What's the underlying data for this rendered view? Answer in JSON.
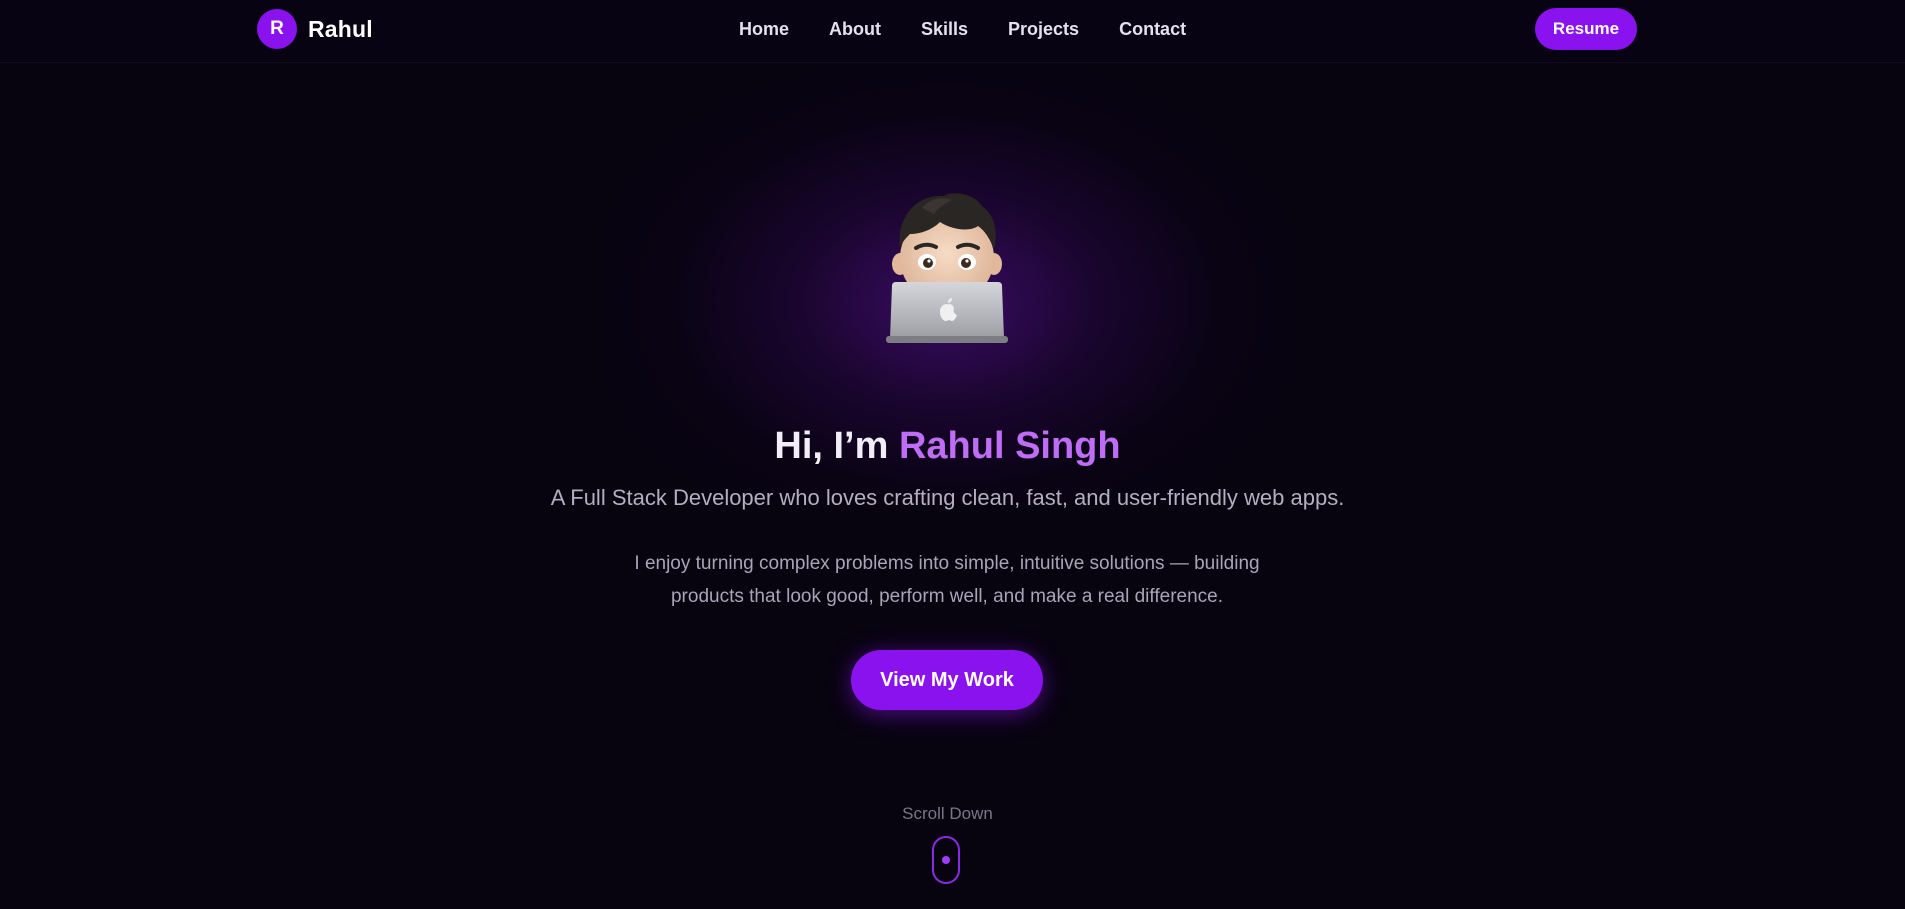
{
  "nav": {
    "brand_initial": "R",
    "brand_name": "Rahul",
    "links": [
      {
        "label": "Home"
      },
      {
        "label": "About"
      },
      {
        "label": "Skills"
      },
      {
        "label": "Projects"
      },
      {
        "label": "Contact"
      }
    ],
    "resume_label": "Resume"
  },
  "hero": {
    "avatar_icon": "memoji-with-laptop-icon",
    "title_prefix": "Hi, I’m ",
    "title_name": "Rahul Singh",
    "subtitle": "A Full Stack Developer who loves crafting clean, fast, and user-friendly web apps.",
    "description": "I enjoy turning complex problems into simple, intuitive solutions — building products that look good, perform well, and make a real difference.",
    "cta_label": "View My Work",
    "scroll_label": "Scroll Down"
  },
  "colors": {
    "background": "#07030f",
    "accent": "#8a12ee",
    "name_highlight": "#bf6cf6",
    "text_primary": "#f2eef8",
    "text_muted": "#b3aec2"
  }
}
